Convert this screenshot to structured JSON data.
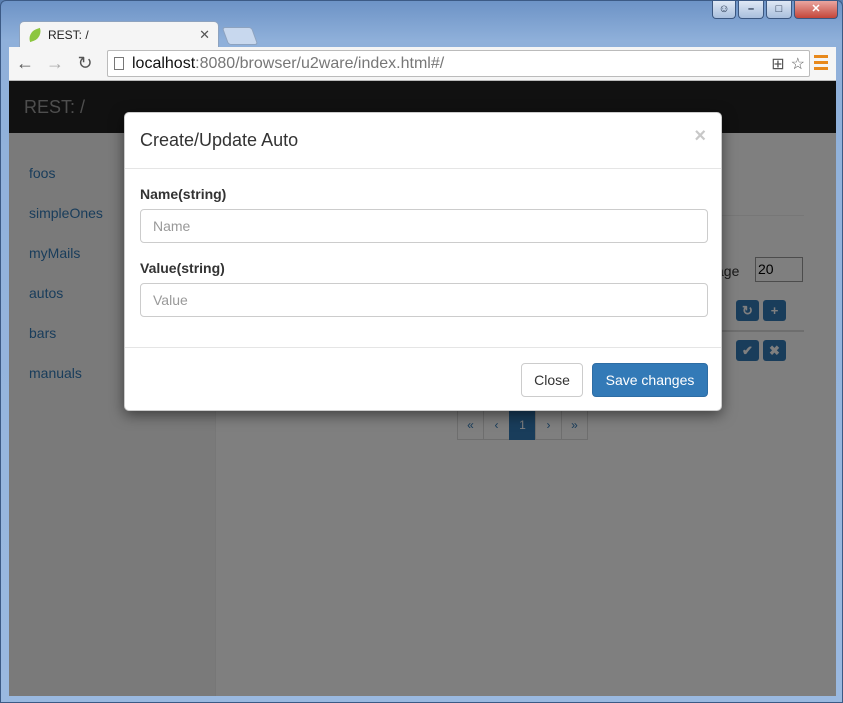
{
  "browser": {
    "tab_title": "REST: /",
    "url_host": "localhost",
    "url_rest": ":8080/browser/u2ware/index.html#/"
  },
  "app": {
    "brand": "REST: /"
  },
  "sidebar": {
    "items": [
      {
        "label": "foos"
      },
      {
        "label": "simpleOnes"
      },
      {
        "label": "myMails"
      },
      {
        "label": "autos"
      },
      {
        "label": "bars"
      },
      {
        "label": "manuals"
      }
    ]
  },
  "main": {
    "per_page_label": "age",
    "per_page_value": "20",
    "pagination": [
      "«",
      "‹",
      "1",
      "›",
      "»"
    ],
    "active_page": "1"
  },
  "modal": {
    "title": "Create/Update Auto",
    "close_glyph": "×",
    "fields": [
      {
        "label": "Name(string)",
        "placeholder": "Name",
        "value": ""
      },
      {
        "label": "Value(string)",
        "placeholder": "Value",
        "value": ""
      }
    ],
    "close_button": "Close",
    "save_button": "Save changes"
  },
  "colors": {
    "primary": "#337ab7",
    "navbar": "#222222",
    "menu_accent": "#e8891c"
  }
}
